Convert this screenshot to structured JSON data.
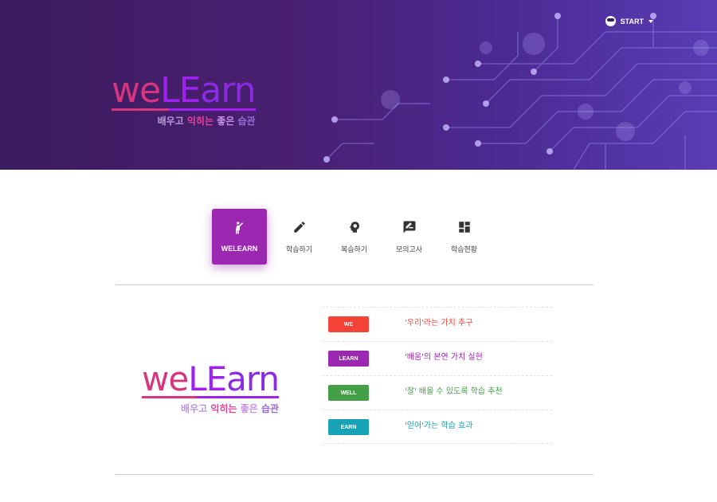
{
  "header": {
    "start_label": "START",
    "logo": {
      "we": "we",
      "le": "LE",
      "rn": "arn",
      "tag": [
        "배우고",
        "익히는",
        "좋은",
        "습관"
      ]
    }
  },
  "tabs": [
    {
      "label": "WELEARN",
      "icon": "person-raising-hand-icon",
      "active": true
    },
    {
      "label": "학습하기",
      "icon": "pencil-icon",
      "active": false
    },
    {
      "label": "복습하기",
      "icon": "brain-head-icon",
      "active": false
    },
    {
      "label": "모의고사",
      "icon": "chat-edit-icon",
      "active": false
    },
    {
      "label": "학습현황",
      "icon": "dashboard-icon",
      "active": false
    }
  ],
  "content": {
    "logo": {
      "we": "we",
      "le": "LE",
      "rn": "arn",
      "tag": [
        "배우고",
        "익히는",
        "좋은",
        "습관"
      ]
    },
    "values": [
      {
        "badge": "WE",
        "text": "'우리'라는 가치 추구",
        "color": "#f44336"
      },
      {
        "badge": "LEARN",
        "text": "'배움'의 본연 가치 실현",
        "color": "#9c27b0"
      },
      {
        "badge": "WELL",
        "text": "'잘' 배울 수 있도록 학습 추천",
        "color": "#43a047"
      },
      {
        "badge": "EARN",
        "text": "'얻어'가는 학습 효과",
        "color": "#17a2b8"
      }
    ]
  }
}
